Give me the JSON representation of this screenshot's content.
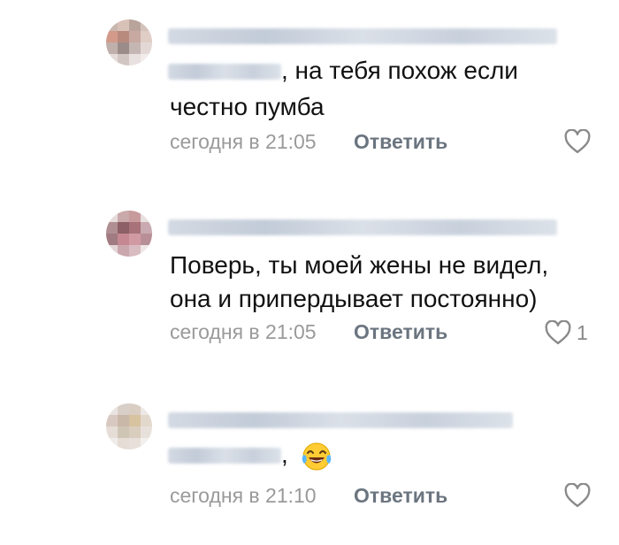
{
  "comments": [
    {
      "text_line1": ", на тебя похож если",
      "text_line2": "честно пумба",
      "time": "сегодня в 21:05",
      "reply": "Ответить",
      "likes": ""
    },
    {
      "text_line1": "Поверь, ты моей жены не видел,",
      "text_line2": "она и припердывает постоянно)",
      "time": "сегодня в 21:05",
      "reply": "Ответить",
      "likes": "1"
    },
    {
      "text_line1": ",",
      "emoji": "tears-of-joy-emoji",
      "time": "сегодня в 21:10",
      "reply": "Ответить",
      "likes": ""
    }
  ],
  "icons": {
    "like": "heart-outline-icon"
  },
  "colors": {
    "meta_gray": "#9a9a9a",
    "reply_gray": "#6b7580",
    "heart_gray": "#8a8a8a"
  }
}
